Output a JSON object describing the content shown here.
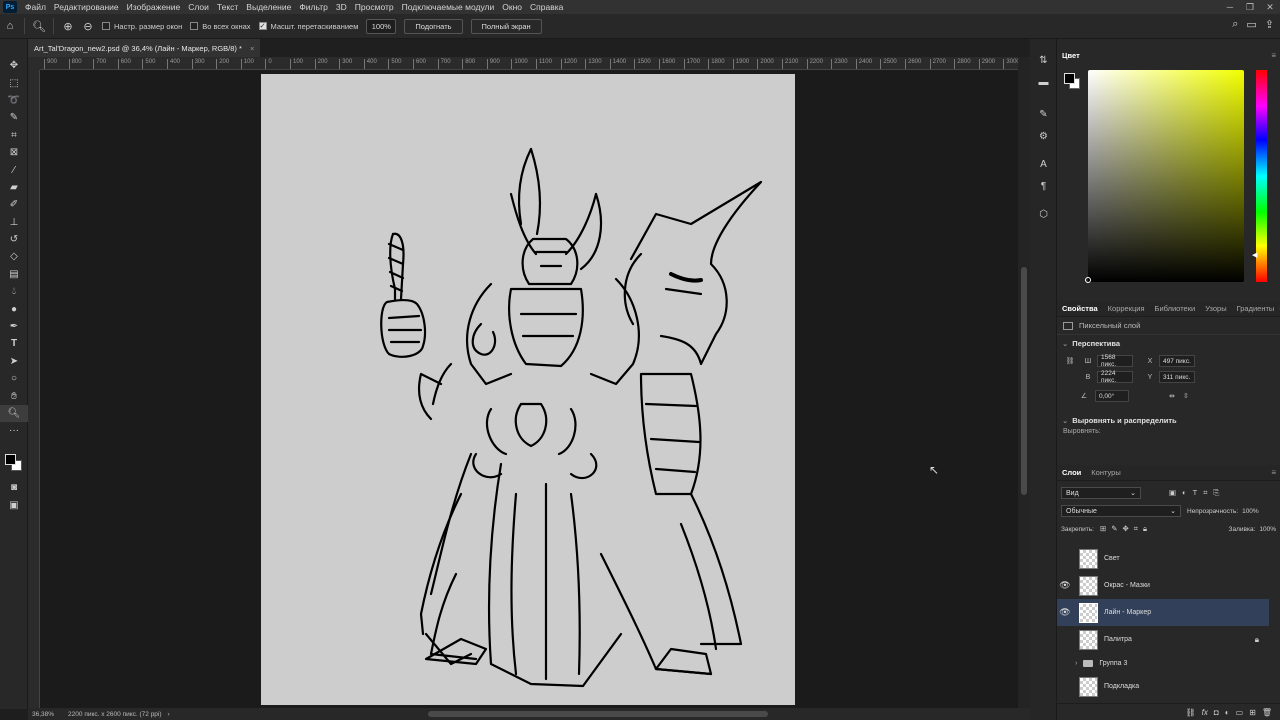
{
  "menu": [
    "Файл",
    "Редактирование",
    "Изображение",
    "Слои",
    "Текст",
    "Выделение",
    "Фильтр",
    "3D",
    "Просмотр",
    "Подключаемые модули",
    "Окно",
    "Справка"
  ],
  "app_icon": "Ps",
  "options": {
    "resize_windows": "Настр. размер окон",
    "all_windows": "Во всех окнах",
    "scrubby_zoom": "Масшт. перетаскиванием",
    "zoom_value": "100%",
    "fit_button": "Подогнать",
    "fullscreen_button": "Полный экран"
  },
  "document_tab": {
    "title": "Art_Tal'Dragon_new2.psd @ 36,4% (Лайн - Маркер, RGB/8) *",
    "close": "×"
  },
  "ruler_ticks": [
    "900",
    "800",
    "700",
    "600",
    "500",
    "400",
    "300",
    "200",
    "100",
    "0",
    "100",
    "200",
    "300",
    "400",
    "500",
    "600",
    "700",
    "800",
    "900",
    "1000",
    "1100",
    "1200",
    "1300",
    "1400",
    "1500",
    "1600",
    "1700",
    "1800",
    "1900",
    "2000",
    "2100",
    "2200",
    "2300",
    "2400",
    "2500",
    "2600",
    "2700",
    "2800",
    "2900",
    "3000"
  ],
  "status": {
    "zoom": "36,38%",
    "doc_size": "2200 пикс. x 2600 пикс. (72 ppi)"
  },
  "color_panel": {
    "title": "Цвет",
    "hue_color": "#f2ff00"
  },
  "properties": {
    "tabs": [
      "Свойства",
      "Коррекция",
      "Библиотеки",
      "Узоры",
      "Градиенты"
    ],
    "layer_type": "Пиксельный слой",
    "section_transform": "Перспектива",
    "w_label": "Ш",
    "w_value": "1568 пикс.",
    "x_label": "X",
    "x_value": "497 пикс.",
    "h_label": "В",
    "h_value": "2224 пикс.",
    "y_label": "Y",
    "y_value": "311 пикс.",
    "angle_value": "0,00°",
    "section_align": "Выровнять и распределить",
    "align_label": "Выровнять:"
  },
  "layers_panel": {
    "tabs": [
      "Слои",
      "Контуры"
    ],
    "filter_kind": "Вид",
    "blend_mode": "Обычные",
    "opacity_label": "Непрозрачность:",
    "opacity_value": "100%",
    "lock_label": "Закрепить:",
    "fill_label": "Заливка:",
    "fill_value": "100%",
    "layers": [
      {
        "name": "Свет",
        "visible": false
      },
      {
        "name": "Окрас - Мазки",
        "visible": true
      },
      {
        "name": "Лайн - Маркер",
        "visible": true,
        "selected": true
      },
      {
        "name": "Палитра",
        "visible": false,
        "locked": true
      },
      {
        "name": "Группа 3",
        "visible": false,
        "group": true
      },
      {
        "name": "Подкладка",
        "visible": false
      }
    ]
  }
}
